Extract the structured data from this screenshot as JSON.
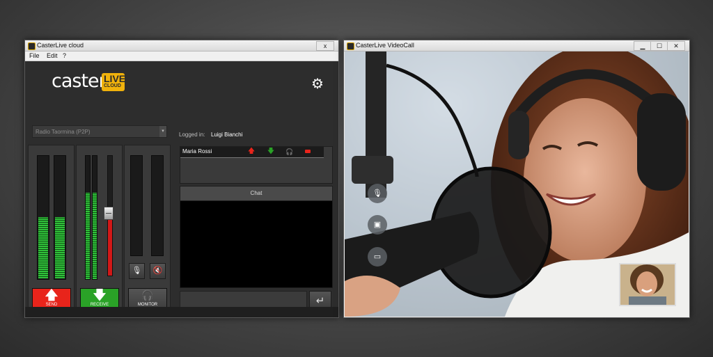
{
  "left_window": {
    "title": "CasterLive cloud",
    "close_label": "x",
    "menu": [
      "File",
      "Edit",
      "?"
    ],
    "logo": {
      "word": "caster",
      "badge_top": "LIVE",
      "badge_bottom": "CLOUD"
    },
    "settings_icon": "gear-icon",
    "station_select": {
      "value": "Radio Taormina (P2P)"
    },
    "logged_in_label": "Logged in:",
    "logged_in_user": "Luigi Bianchi",
    "send": {
      "label": "SEND",
      "color": "#e8241b",
      "level": 0.5
    },
    "receive": {
      "label": "RECEIVE",
      "color": "#2aa227",
      "level": 0.7,
      "gain": 0.52
    },
    "monitor": {
      "label": "MONITOR",
      "level": 0.0
    },
    "users": [
      {
        "name": "Maria Rossi",
        "icons": [
          "arrow-up-icon",
          "arrow-down-icon",
          "headphones-icon",
          "camera-icon"
        ]
      }
    ],
    "chat": {
      "header": "Chat",
      "input_value": ""
    }
  },
  "right_window": {
    "title": "CasterLive VideoCall",
    "controls": [
      "minimize-icon",
      "maximize-icon",
      "close-icon"
    ],
    "buttons": [
      "microphone-icon",
      "camera-icon",
      "picture-in-picture-icon"
    ]
  }
}
